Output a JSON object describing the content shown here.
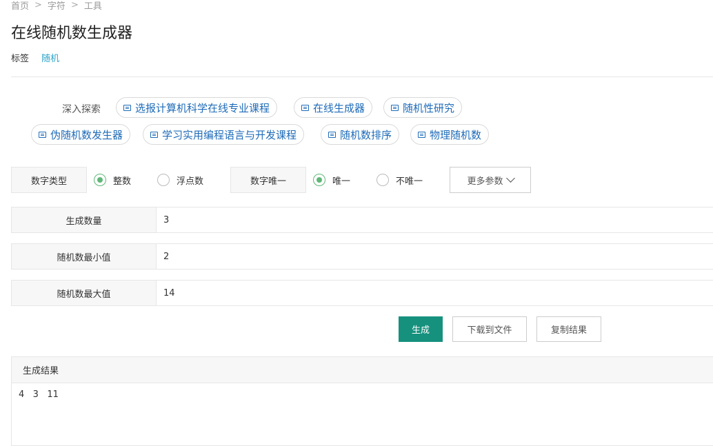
{
  "breadcrumb": {
    "items": [
      "首页",
      "字符",
      "工具"
    ],
    "separator": ">"
  },
  "page": {
    "title": "在线随机数生成器"
  },
  "tags": {
    "label": "标签",
    "items": [
      "随机"
    ]
  },
  "explore": {
    "label": "深入探索",
    "chips": [
      "选报计算机科学在线专业课程",
      "在线生成器",
      "随机性研究",
      "伪随机数发生器",
      "学习实用编程语言与开发课程",
      "随机数排序",
      "物理随机数"
    ]
  },
  "options": {
    "number_type": {
      "label": "数字类型",
      "choices": [
        "整数",
        "浮点数"
      ],
      "selected": "整数"
    },
    "unique": {
      "label": "数字唯一",
      "choices": [
        "唯一",
        "不唯一"
      ],
      "selected": "唯一"
    },
    "more_label": "更多参数",
    "more_icon": "chevron-down-icon"
  },
  "fields": {
    "count": {
      "label": "生成数量",
      "value": "3"
    },
    "min": {
      "label": "随机数最小值",
      "value": "2"
    },
    "max": {
      "label": "随机数最大值",
      "value": "14"
    }
  },
  "actions": {
    "generate": "生成",
    "download": "下载到文件",
    "copy": "复制结果"
  },
  "result": {
    "header": "生成结果",
    "text": "4   3   11"
  },
  "colors": {
    "accent": "#16917e",
    "radio_checked": "#5fb878",
    "link": "#1e6bb8",
    "tag_link": "#2fa4c8"
  }
}
